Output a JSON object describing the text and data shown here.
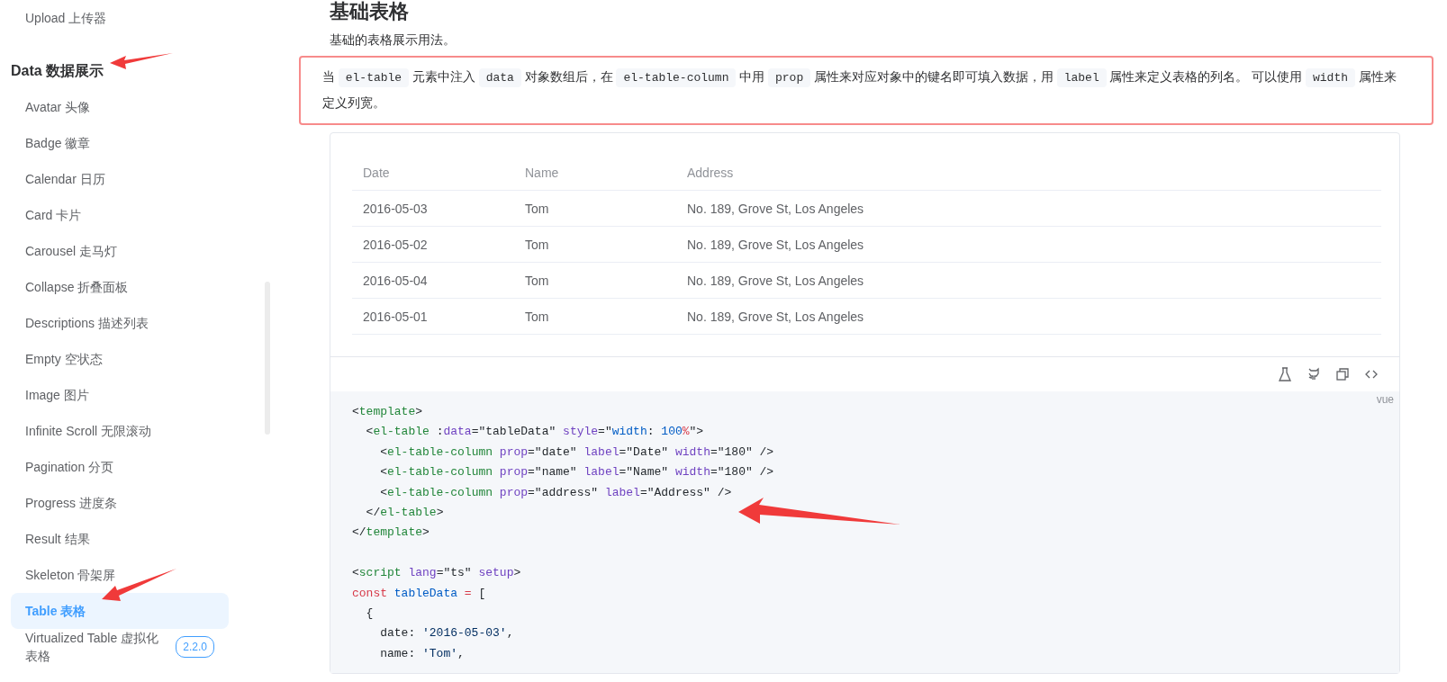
{
  "sidebar": {
    "items": [
      {
        "kind": "item",
        "label": "Upload 上传器",
        "selected": false
      },
      {
        "kind": "group",
        "label": "Data 数据展示"
      },
      {
        "kind": "item",
        "label": "Avatar 头像",
        "selected": false
      },
      {
        "kind": "item",
        "label": "Badge 徽章",
        "selected": false
      },
      {
        "kind": "item",
        "label": "Calendar 日历",
        "selected": false
      },
      {
        "kind": "item",
        "label": "Card 卡片",
        "selected": false
      },
      {
        "kind": "item",
        "label": "Carousel 走马灯",
        "selected": false
      },
      {
        "kind": "item",
        "label": "Collapse 折叠面板",
        "selected": false
      },
      {
        "kind": "item",
        "label": "Descriptions 描述列表",
        "selected": false
      },
      {
        "kind": "item",
        "label": "Empty 空状态",
        "selected": false
      },
      {
        "kind": "item",
        "label": "Image 图片",
        "selected": false
      },
      {
        "kind": "item",
        "label": "Infinite Scroll 无限滚动",
        "selected": false
      },
      {
        "kind": "item",
        "label": "Pagination 分页",
        "selected": false
      },
      {
        "kind": "item",
        "label": "Progress 进度条",
        "selected": false
      },
      {
        "kind": "item",
        "label": "Result 结果",
        "selected": false
      },
      {
        "kind": "item",
        "label": "Skeleton 骨架屏",
        "selected": false
      },
      {
        "kind": "item",
        "label": "Table 表格",
        "selected": true
      },
      {
        "kind": "item",
        "label": "Virtualized Table 虚拟化表格",
        "selected": false,
        "badge": "2.2.0"
      }
    ]
  },
  "page_title": "基础表格",
  "intro": "基础的表格展示用法。",
  "description": [
    {
      "kind": "text",
      "text": "当 "
    },
    {
      "kind": "code",
      "text": "el-table"
    },
    {
      "kind": "text",
      "text": " 元素中注入 "
    },
    {
      "kind": "code",
      "text": "data"
    },
    {
      "kind": "text",
      "text": " 对象数组后，在 "
    },
    {
      "kind": "code",
      "text": "el-table-column"
    },
    {
      "kind": "text",
      "text": " 中用 "
    },
    {
      "kind": "code",
      "text": "prop"
    },
    {
      "kind": "text",
      "text": " 属性来对应对象中的键名即可填入数据，用 "
    },
    {
      "kind": "code",
      "text": "label"
    },
    {
      "kind": "text",
      "text": " 属性来定义表格的列名。 可以使用 "
    },
    {
      "kind": "code",
      "text": "width"
    },
    {
      "kind": "text",
      "text": " 属性来定义列宽。"
    }
  ],
  "table": {
    "columns": [
      "Date",
      "Name",
      "Address"
    ],
    "rows": [
      [
        "2016-05-03",
        "Tom",
        "No. 189, Grove St, Los Angeles"
      ],
      [
        "2016-05-02",
        "Tom",
        "No. 189, Grove St, Los Angeles"
      ],
      [
        "2016-05-04",
        "Tom",
        "No. 189, Grove St, Los Angeles"
      ],
      [
        "2016-05-01",
        "Tom",
        "No. 189, Grove St, Los Angeles"
      ]
    ]
  },
  "code": {
    "language": "vue",
    "lines": [
      {
        "tokens": [
          {
            "text": "<",
            "kind": "p"
          },
          {
            "text": "template",
            "kind": "tag"
          },
          {
            "text": ">",
            "kind": "p"
          }
        ]
      },
      {
        "tokens": [
          {
            "text": "  <",
            "kind": "p"
          },
          {
            "text": "el-table",
            "kind": "tag"
          },
          {
            "text": " :",
            "kind": "p"
          },
          {
            "text": "data",
            "kind": "attr"
          },
          {
            "text": "=\"tableData\" ",
            "kind": "p"
          },
          {
            "text": "style",
            "kind": "attr"
          },
          {
            "text": "=\"",
            "kind": "p"
          },
          {
            "text": "width",
            "kind": "var"
          },
          {
            "text": ": ",
            "kind": "p"
          },
          {
            "text": "100",
            "kind": "var"
          },
          {
            "text": "%",
            "kind": "kw"
          },
          {
            "text": "\">",
            "kind": "p"
          }
        ]
      },
      {
        "tokens": [
          {
            "text": "    <",
            "kind": "p"
          },
          {
            "text": "el-table-column",
            "kind": "tag"
          },
          {
            "text": " prop",
            "kind": "attr"
          },
          {
            "text": "=\"date\" ",
            "kind": "p"
          },
          {
            "text": "label",
            "kind": "attr"
          },
          {
            "text": "=\"Date\" ",
            "kind": "p"
          },
          {
            "text": "width",
            "kind": "attr"
          },
          {
            "text": "=\"180\" />",
            "kind": "p"
          }
        ]
      },
      {
        "tokens": [
          {
            "text": "    <",
            "kind": "p"
          },
          {
            "text": "el-table-column",
            "kind": "tag"
          },
          {
            "text": " prop",
            "kind": "attr"
          },
          {
            "text": "=\"name\" ",
            "kind": "p"
          },
          {
            "text": "label",
            "kind": "attr"
          },
          {
            "text": "=\"Name\" ",
            "kind": "p"
          },
          {
            "text": "width",
            "kind": "attr"
          },
          {
            "text": "=\"180\" />",
            "kind": "p"
          }
        ]
      },
      {
        "tokens": [
          {
            "text": "    <",
            "kind": "p"
          },
          {
            "text": "el-table-column",
            "kind": "tag"
          },
          {
            "text": " prop",
            "kind": "attr"
          },
          {
            "text": "=\"address\" ",
            "kind": "p"
          },
          {
            "text": "label",
            "kind": "attr"
          },
          {
            "text": "=\"Address\" />",
            "kind": "p"
          }
        ]
      },
      {
        "tokens": [
          {
            "text": "  </",
            "kind": "p"
          },
          {
            "text": "el-table",
            "kind": "tag"
          },
          {
            "text": ">",
            "kind": "p"
          }
        ]
      },
      {
        "tokens": [
          {
            "text": "</",
            "kind": "p"
          },
          {
            "text": "template",
            "kind": "tag"
          },
          {
            "text": ">",
            "kind": "p"
          }
        ]
      },
      {
        "blank_before": true,
        "tokens": [
          {
            "text": "<",
            "kind": "p"
          },
          {
            "text": "script",
            "kind": "tag"
          },
          {
            "text": " lang",
            "kind": "attr"
          },
          {
            "text": "=\"ts\" ",
            "kind": "p"
          },
          {
            "text": "setup",
            "kind": "attr"
          },
          {
            "text": ">",
            "kind": "p"
          }
        ]
      },
      {
        "tokens": [
          {
            "text": "const",
            "kind": "kw"
          },
          {
            "text": " tableData",
            "kind": "var"
          },
          {
            "text": " =",
            "kind": "kw"
          },
          {
            "text": " [",
            "kind": "p"
          }
        ]
      },
      {
        "tokens": [
          {
            "text": "  {",
            "kind": "p"
          }
        ]
      },
      {
        "tokens": [
          {
            "text": "    date: ",
            "kind": "p"
          },
          {
            "text": "'2016-05-03'",
            "kind": "str"
          },
          {
            "text": ",",
            "kind": "p"
          }
        ]
      },
      {
        "tokens": [
          {
            "text": "    name: ",
            "kind": "p"
          },
          {
            "text": "'Tom'",
            "kind": "str"
          },
          {
            "text": ",",
            "kind": "p"
          }
        ]
      }
    ]
  }
}
